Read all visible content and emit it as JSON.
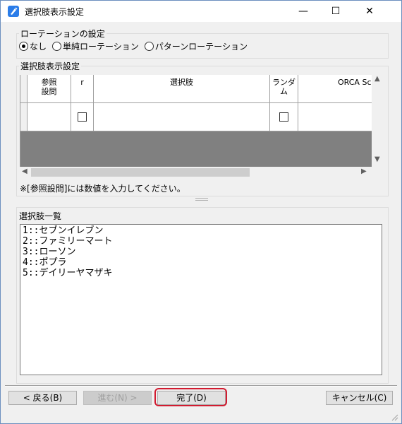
{
  "window": {
    "title": "選択肢表示設定",
    "minimize": "—",
    "maximize": "☐",
    "close": "✕"
  },
  "rotation": {
    "group_title": "ローテーションの設定",
    "options": [
      "なし",
      "単純ローテーション",
      "パターンローテーション"
    ],
    "selected": "なし"
  },
  "display": {
    "group_title": "選択肢表示設定",
    "columns": [
      "参照\n設問",
      "r",
      "選択肢",
      "ランダム",
      "ORCA Sc"
    ],
    "rows": [
      {
        "ref": "",
        "r": false,
        "choice": "",
        "random": false,
        "orca": ""
      }
    ],
    "note": "※[参照設問]には数値を入力してください。"
  },
  "choices": {
    "label": "選択肢一覧",
    "items": [
      "1::セブンイレブン",
      "2::ファミリーマート",
      "3::ローソン",
      "4::ポプラ",
      "5::デイリーヤマザキ"
    ]
  },
  "buttons": {
    "back": "< 戻る(B)",
    "next": "進む(N) >",
    "done": "完了(D)",
    "cancel": "キャンセル(C)"
  }
}
